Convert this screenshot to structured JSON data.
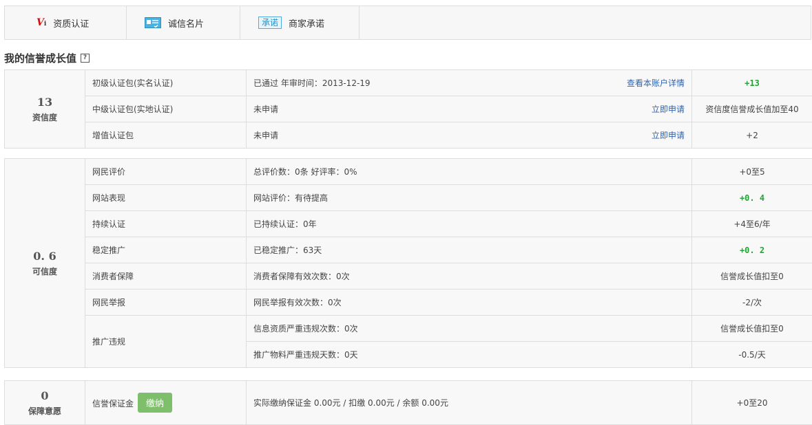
{
  "tabs": [
    {
      "label": "资质认证",
      "icon": "vi-icon"
    },
    {
      "label": "诚信名片",
      "icon": "card-icon"
    },
    {
      "label": "商家承诺",
      "badge": "承诺"
    }
  ],
  "section_title": "我的信誉成长值",
  "help_mark": "?",
  "vi_mark": "V",
  "vi_sub": "i",
  "groups": [
    {
      "score": "13",
      "score_label": "资信度",
      "rows": [
        {
          "name": "初级认证包(实名认证)",
          "detail": "已通过  年审时间：2013-12-19",
          "link": "查看本账户详情",
          "value": "+13"
        },
        {
          "name": "中级认证包(实地认证)",
          "detail": "未申请",
          "link": "立即申请",
          "value": "资信度信誉成长值加至40"
        },
        {
          "name": "增值认证包",
          "detail": "未申请",
          "link": "立即申请",
          "value": "+2"
        }
      ]
    },
    {
      "score": "0. 6",
      "score_label": "可信度",
      "rows": [
        {
          "name": "网民评价",
          "detail": "总评价数：0条  好评率：0%",
          "value": "+0至5"
        },
        {
          "name": "网站表现",
          "detail": "网站评价：有待提高",
          "value": "+0. 4"
        },
        {
          "name": "持续认证",
          "detail": "已持续认证：0年",
          "value": "+4至6/年"
        },
        {
          "name": "稳定推广",
          "detail": "已稳定推广：63天",
          "value": "+0. 2"
        },
        {
          "name": "消费者保障",
          "detail": "消费者保障有效次数：0次",
          "value": "信誉成长值扣至0"
        },
        {
          "name": "网民举报",
          "detail": "网民举报有效次数：0次",
          "value": "-2/次"
        },
        {
          "name": "推广违规",
          "detail": "信息资质严重违规次数：0次",
          "value": "信誉成长值扣至0"
        },
        {
          "detail": "推广物料严重违规天数：0天",
          "value": "-0.5/天"
        }
      ]
    },
    {
      "score": "0",
      "score_label": "保障意愿",
      "rows": [
        {
          "name": "信誉保证金",
          "button": "缴纳",
          "detail": "实际缴纳保证金  0.00元  /  扣缴  0.00元  /  余额  0.00元",
          "value": "+0至20"
        }
      ]
    }
  ]
}
